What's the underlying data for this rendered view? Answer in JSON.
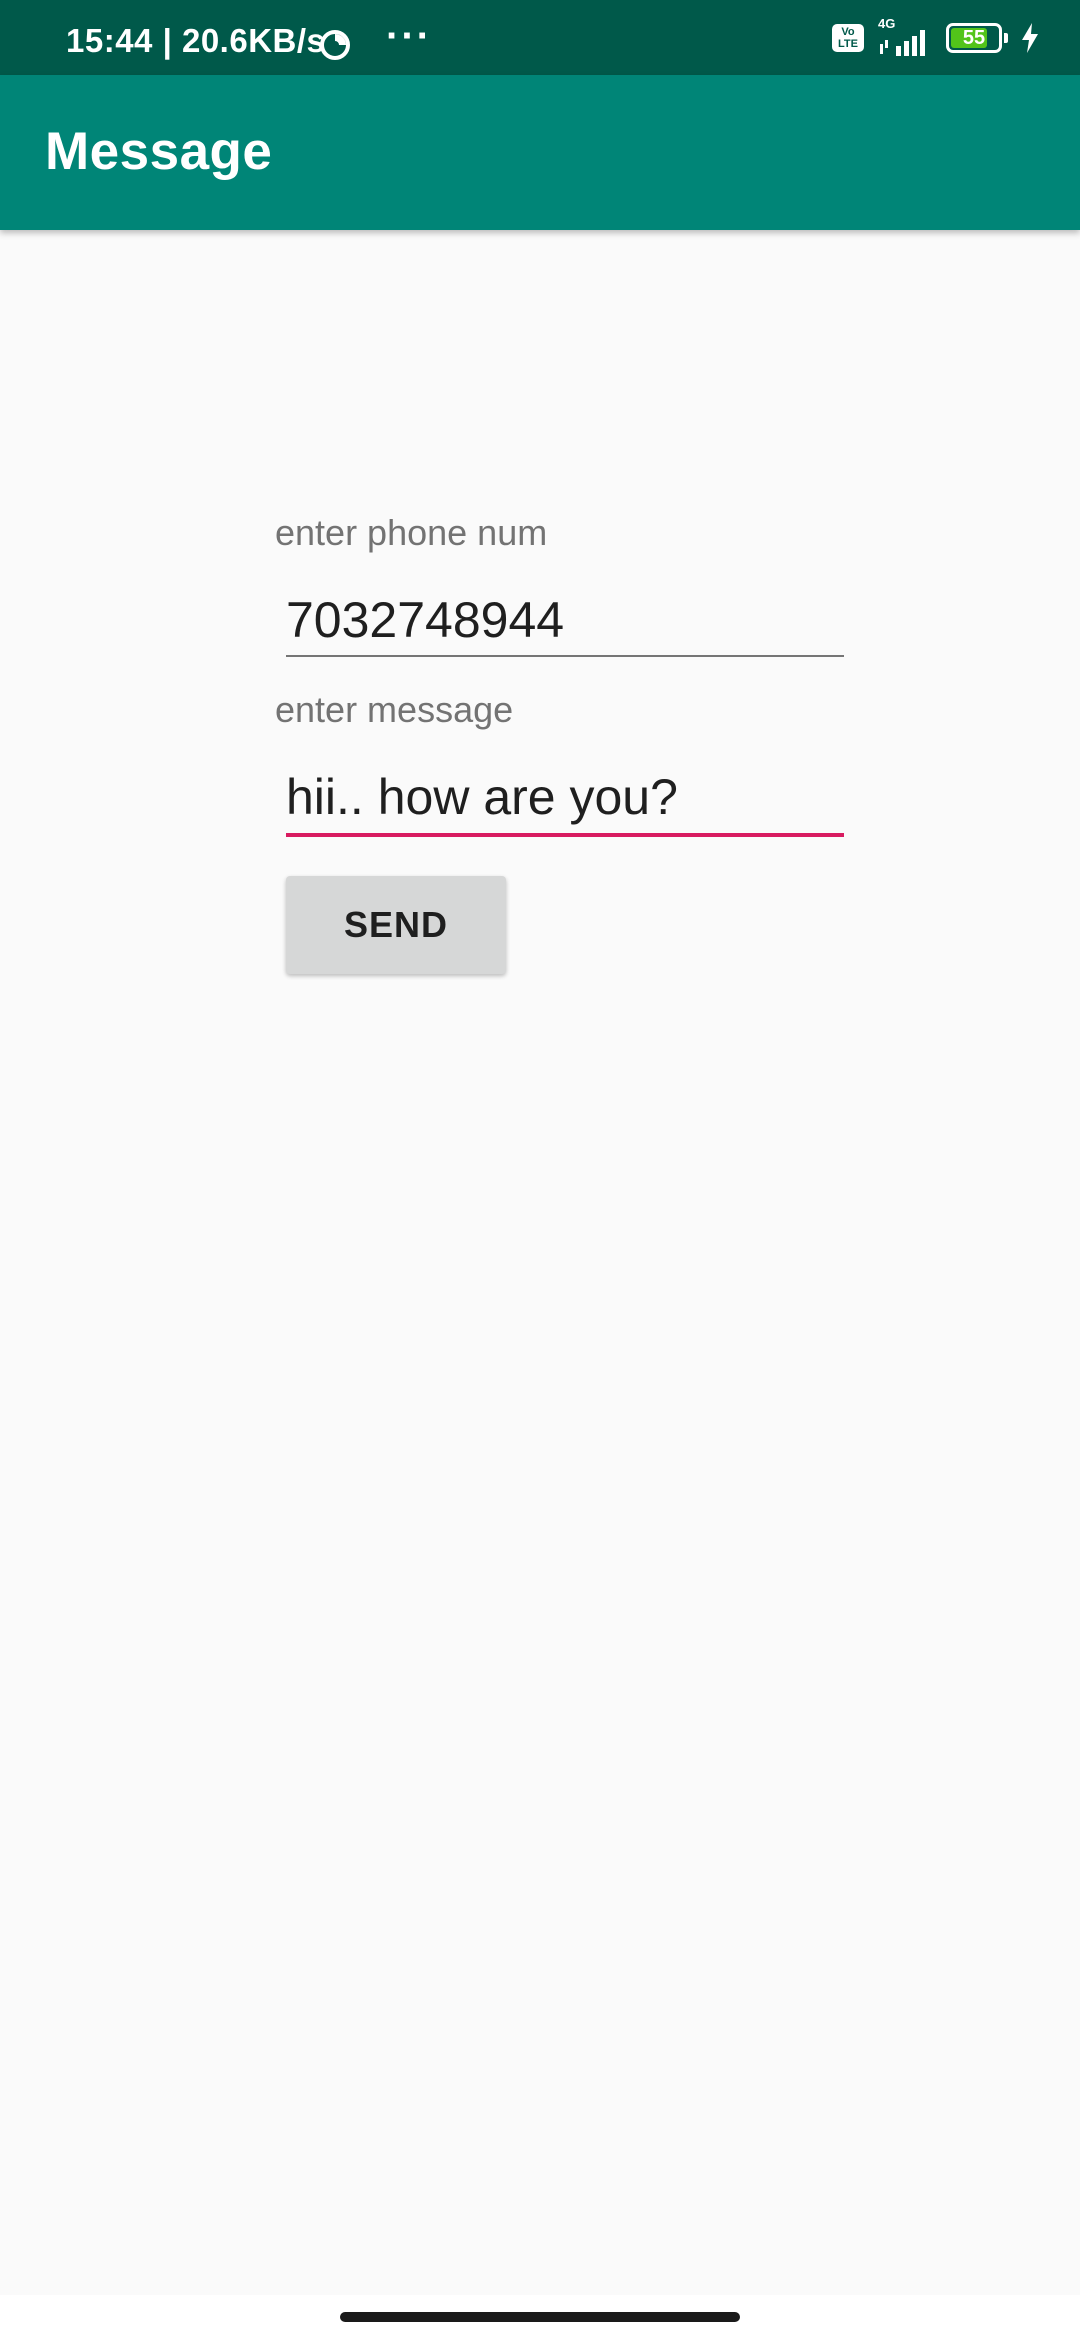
{
  "status_bar": {
    "time_speed": "15:44 | 20.6KB/s",
    "more": "···",
    "volte": "Vo LTE",
    "network": "4G",
    "battery": "55",
    "icons": [
      "sync-icon",
      "volte-icon",
      "signal-icon",
      "battery-icon",
      "charging-icon"
    ],
    "colors": {
      "background": "#00594a",
      "battery_fill": "#52c41a"
    }
  },
  "app_bar": {
    "title": "Message",
    "color": "#008577"
  },
  "form": {
    "phone": {
      "label": "enter phone num",
      "value": "7032748944"
    },
    "message": {
      "label": "enter message",
      "value": "hii.. how are you?",
      "focused": true,
      "accent": "#d81b60"
    },
    "send_label": "SEND"
  }
}
